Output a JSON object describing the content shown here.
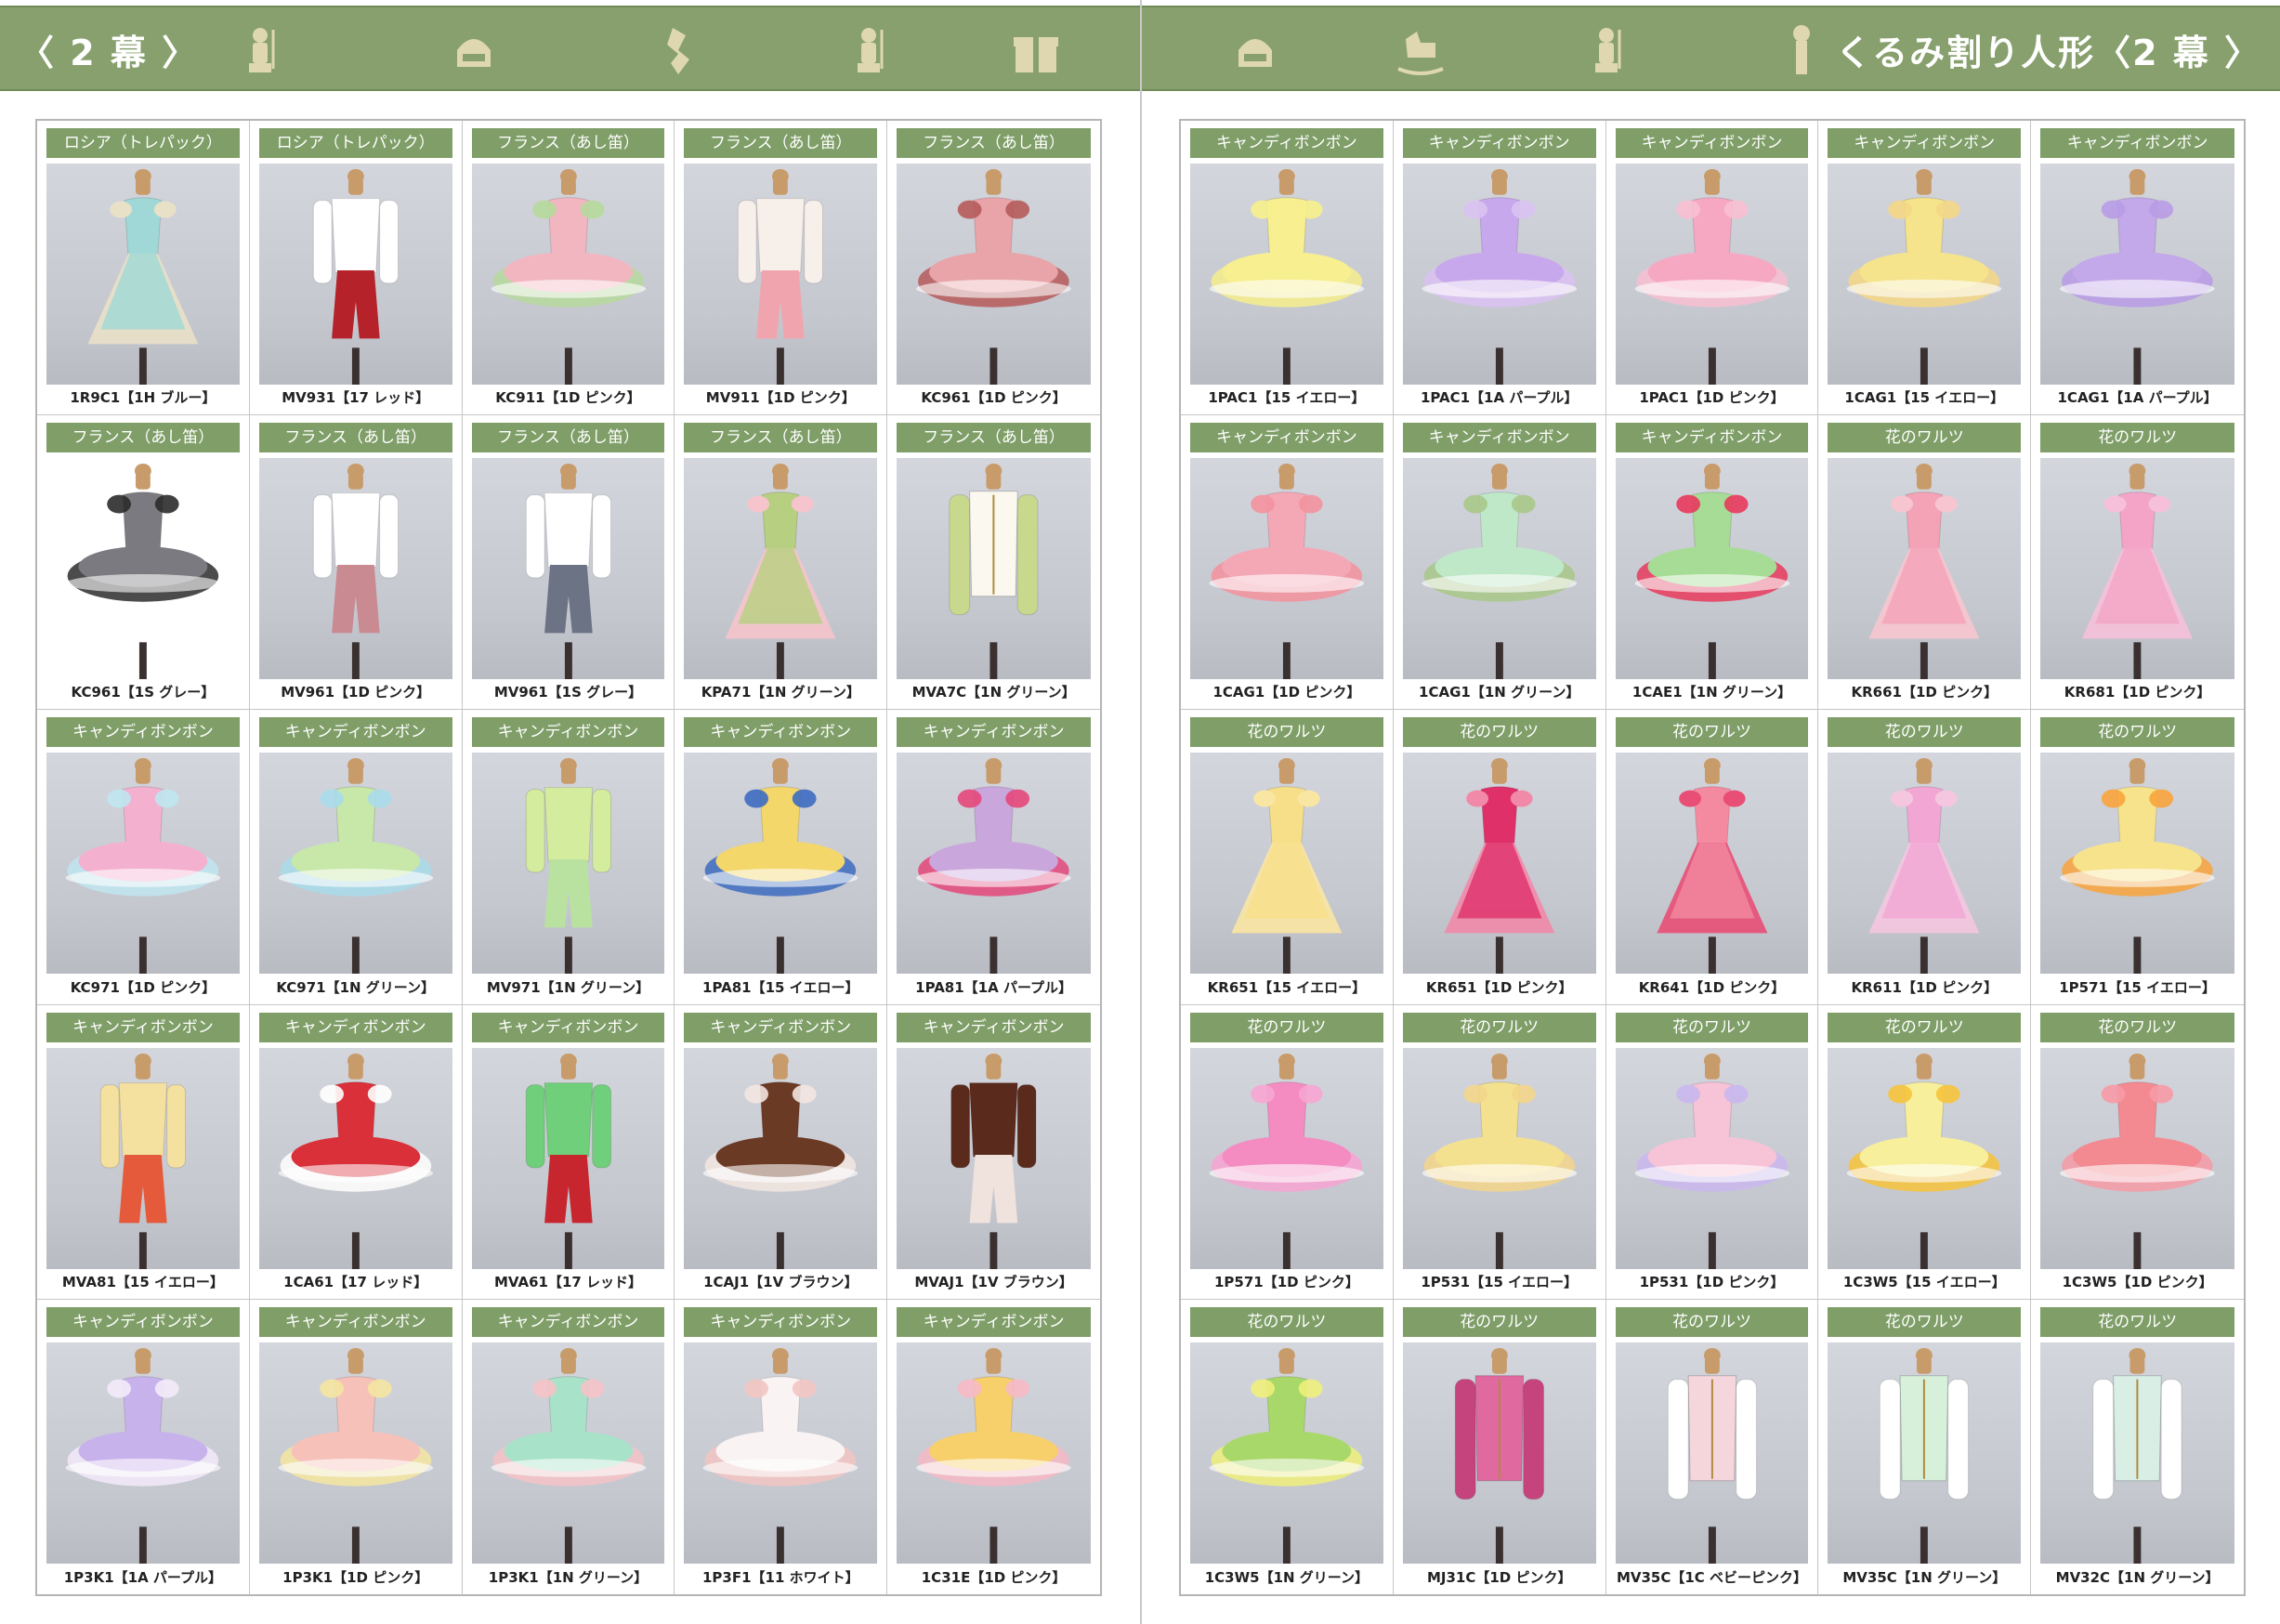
{
  "left_page": {
    "header": "〈 2 幕 〉",
    "items": [
      {
        "category": "ロシア（トレパック）",
        "code": "1R9C1【1H ブルー】",
        "colors": [
          "#9fd8d6",
          "#e9e0c8"
        ],
        "kind": "dress"
      },
      {
        "category": "ロシア（トレパック）",
        "code": "MV931【17 レッド】",
        "colors": [
          "#ffffff",
          "#b5222a"
        ],
        "kind": "pants"
      },
      {
        "category": "フランス（あし笛）",
        "code": "KC911【1D ピンク】",
        "colors": [
          "#f2b6c1",
          "#b6d99c"
        ],
        "kind": "tutu"
      },
      {
        "category": "フランス（あし笛）",
        "code": "MV911【1D ピンク】",
        "colors": [
          "#f7f0ea",
          "#f0a5ae"
        ],
        "kind": "pants"
      },
      {
        "category": "フランス（あし笛）",
        "code": "KC961【1D ピンク】",
        "colors": [
          "#e8a4a8",
          "#b65a5a"
        ],
        "kind": "tutu"
      },
      {
        "category": "フランス（あし笛）",
        "code": "KC961【1S グレー】",
        "colors": [
          "#7a7a80",
          "#2b2b2b"
        ],
        "kind": "tutu",
        "white": true
      },
      {
        "category": "フランス（あし笛）",
        "code": "MV961【1D ピンク】",
        "colors": [
          "#ffffff",
          "#c98a92"
        ],
        "kind": "pants"
      },
      {
        "category": "フランス（あし笛）",
        "code": "MV961【1S グレー】",
        "colors": [
          "#ffffff",
          "#6c7385"
        ],
        "kind": "pants"
      },
      {
        "category": "フランス（あし笛）",
        "code": "KPA71【1N グリーン】",
        "colors": [
          "#b7cf80",
          "#f6c4cc"
        ],
        "kind": "dress"
      },
      {
        "category": "フランス（あし笛）",
        "code": "MVA7C【1N グリーン】",
        "colors": [
          "#fbf8ef",
          "#c8d98e"
        ],
        "kind": "jacket"
      },
      {
        "category": "キャンディボンボン",
        "code": "KC971【1D ピンク】",
        "colors": [
          "#f4b0cf",
          "#bfe6f0"
        ],
        "kind": "tutu"
      },
      {
        "category": "キャンディボンボン",
        "code": "KC971【1N グリーン】",
        "colors": [
          "#c7e8a8",
          "#a8dcea"
        ],
        "kind": "tutu"
      },
      {
        "category": "キャンディボンボン",
        "code": "MV971【1N グリーン】",
        "colors": [
          "#d4ec9e",
          "#b9e2a0"
        ],
        "kind": "pants"
      },
      {
        "category": "キャンディボンボン",
        "code": "1PA81【15 イエロー】",
        "colors": [
          "#f3d76b",
          "#3d6cc0"
        ],
        "kind": "tutu"
      },
      {
        "category": "キャンディボンボン",
        "code": "1PA81【1A パープル】",
        "colors": [
          "#c9a6dc",
          "#e4477a"
        ],
        "kind": "tutu"
      },
      {
        "category": "キャンディボンボン",
        "code": "MVA81【15 イエロー】",
        "colors": [
          "#f4e1a0",
          "#e55a3a"
        ],
        "kind": "pants"
      },
      {
        "category": "キャンディボンボン",
        "code": "1CA61【17 レッド】",
        "colors": [
          "#d9303a",
          "#ffffff"
        ],
        "kind": "tutu"
      },
      {
        "category": "キャンディボンボン",
        "code": "MVA61【17 レッド】",
        "colors": [
          "#6fcf7a",
          "#c7262e"
        ],
        "kind": "pants"
      },
      {
        "category": "キャンディボンボン",
        "code": "1CAJ1【1V ブラウン】",
        "colors": [
          "#6b3a25",
          "#f2e6e0"
        ],
        "kind": "tutu"
      },
      {
        "category": "キャンディボンボン",
        "code": "MVAJ1【1V ブラウン】",
        "colors": [
          "#5a2a1c",
          "#f0e2dc"
        ],
        "kind": "pants"
      },
      {
        "category": "キャンディボンボン",
        "code": "1P3K1【1A パープル】",
        "colors": [
          "#c8b2ec",
          "#f3eafa"
        ],
        "kind": "tutu"
      },
      {
        "category": "キャンディボンボン",
        "code": "1P3K1【1D ピンク】",
        "colors": [
          "#f6c1b8",
          "#f5e6a0"
        ],
        "kind": "tutu"
      },
      {
        "category": "キャンディボンボン",
        "code": "1P3K1【1N グリーン】",
        "colors": [
          "#a8e2c8",
          "#f4c3c8"
        ],
        "kind": "tutu"
      },
      {
        "category": "キャンディボンボン",
        "code": "1P3F1【11 ホワイト】",
        "colors": [
          "#faf3f3",
          "#f2c5c2"
        ],
        "kind": "tutu"
      },
      {
        "category": "キャンディボンボン",
        "code": "1C31E【1D ピンク】",
        "colors": [
          "#f7d06c",
          "#f6b9c4"
        ],
        "kind": "tutu"
      }
    ]
  },
  "right_page": {
    "header": "くるみ割り人形〈2 幕 〉",
    "items": [
      {
        "category": "キャンディボンボン",
        "code": "1PAC1【15 イエロー】",
        "colors": [
          "#f7ef90",
          "#f6ef8c"
        ],
        "kind": "tutu"
      },
      {
        "category": "キャンディボンボン",
        "code": "1PAC1【1A パープル】",
        "colors": [
          "#c8a8ec",
          "#d9c2f2"
        ],
        "kind": "tutu"
      },
      {
        "category": "キャンディボンボン",
        "code": "1PAC1【1D ピンク】",
        "colors": [
          "#f6a8c2",
          "#f8bfd2"
        ],
        "kind": "tutu"
      },
      {
        "category": "キャンディボンボン",
        "code": "1CAG1【15 イエロー】",
        "colors": [
          "#f6e48c",
          "#f4d785"
        ],
        "kind": "tutu"
      },
      {
        "category": "キャンディボンボン",
        "code": "1CAG1【1A パープル】",
        "colors": [
          "#c3a8ea",
          "#b89be6"
        ],
        "kind": "tutu"
      },
      {
        "category": "キャンディボンボン",
        "code": "1CAG1【1D ピンク】",
        "colors": [
          "#f4a8b6",
          "#f3929e"
        ],
        "kind": "tutu"
      },
      {
        "category": "キャンディボンボン",
        "code": "1CAG1【1N グリーン】",
        "colors": [
          "#bfe8c8",
          "#a9c88a"
        ],
        "kind": "tutu"
      },
      {
        "category": "キャンディボンボン",
        "code": "1CAE1【1N グリーン】",
        "colors": [
          "#a6dc95",
          "#e8395c"
        ],
        "kind": "tutu"
      },
      {
        "category": "花のワルツ",
        "code": "KR661【1D ピンク】",
        "colors": [
          "#f4a2b6",
          "#f7c5cf"
        ],
        "kind": "dress"
      },
      {
        "category": "花のワルツ",
        "code": "KR681【1D ピンク】",
        "colors": [
          "#f4a4c6",
          "#f6c1d8"
        ],
        "kind": "dress"
      },
      {
        "category": "花のワルツ",
        "code": "KR651【15 イエロー】",
        "colors": [
          "#f7df8a",
          "#f9e6a2"
        ],
        "kind": "dress"
      },
      {
        "category": "花のワルツ",
        "code": "KR651【1D ピンク】",
        "colors": [
          "#e0306a",
          "#f08aa8"
        ],
        "kind": "dress"
      },
      {
        "category": "花のワルツ",
        "code": "KR641【1D ピンク】",
        "colors": [
          "#f38aa0",
          "#e84e76"
        ],
        "kind": "dress"
      },
      {
        "category": "花のワルツ",
        "code": "KR611【1D ピンク】",
        "colors": [
          "#f2a6d4",
          "#f5c6e0"
        ],
        "kind": "dress"
      },
      {
        "category": "花のワルツ",
        "code": "1P571【15 イエロー】",
        "colors": [
          "#f7e38c",
          "#f8a43c"
        ],
        "kind": "tutu"
      },
      {
        "category": "花のワルツ",
        "code": "1P571【1D ピンク】",
        "colors": [
          "#f48cc2",
          "#f7a5d2"
        ],
        "kind": "tutu"
      },
      {
        "category": "花のワルツ",
        "code": "1P531【15 イエロー】",
        "colors": [
          "#f4e190",
          "#f3d68a"
        ],
        "kind": "tutu"
      },
      {
        "category": "花のワルツ",
        "code": "1P531【1D ピンク】",
        "colors": [
          "#f7c3d6",
          "#c9b7ee"
        ],
        "kind": "tutu"
      },
      {
        "category": "花のワルツ",
        "code": "1C3W5【15 イエロー】",
        "colors": [
          "#f7ef9c",
          "#f6c33a"
        ],
        "kind": "tutu"
      },
      {
        "category": "花のワルツ",
        "code": "1C3W5【1D ピンク】",
        "colors": [
          "#f38a92",
          "#f69aa6"
        ],
        "kind": "tutu"
      },
      {
        "category": "花のワルツ",
        "code": "1C3W5【1N グリーン】",
        "colors": [
          "#a9d86a",
          "#eef07a"
        ],
        "kind": "tutu"
      },
      {
        "category": "花のワルツ",
        "code": "MJ31C【1D ピンク】",
        "colors": [
          "#e06aa0",
          "#c6447e"
        ],
        "kind": "jacket"
      },
      {
        "category": "花のワルツ",
        "code": "MV35C【1C ベビーピンク】",
        "colors": [
          "#f5d6dd",
          "#ffffff"
        ],
        "kind": "jacket"
      },
      {
        "category": "花のワルツ",
        "code": "MV35C【1N グリーン】",
        "colors": [
          "#d7f0da",
          "#ffffff"
        ],
        "kind": "jacket"
      },
      {
        "category": "花のワルツ",
        "code": "MV32C【1N グリーン】",
        "colors": [
          "#d9efe6",
          "#ffffff"
        ],
        "kind": "jacket"
      }
    ]
  },
  "header_icons_left": [
    "mouse-soldier-icon",
    "nutcracker-head-icon",
    "ribbon-candy-icon",
    "mouse-soldier-icon",
    "gift-box-icon"
  ],
  "header_icons_right": [
    "nutcracker-head-icon",
    "rocking-horse-icon",
    "mouse-soldier-icon",
    "grandfather-clock-icon"
  ],
  "accent": "#87a06d"
}
